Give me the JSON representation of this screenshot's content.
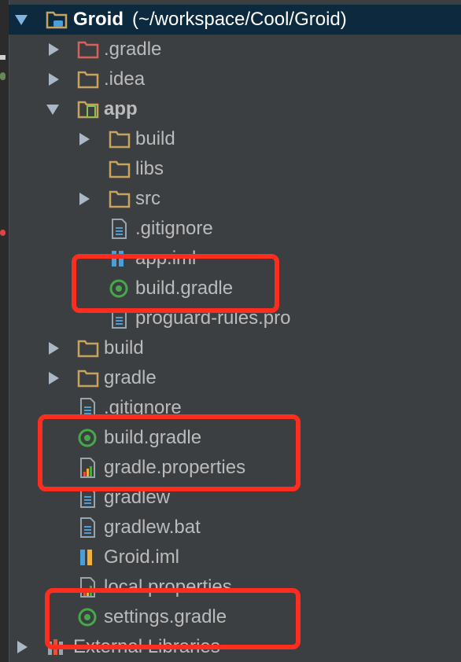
{
  "project": {
    "name": "Groid",
    "path": "(~/workspace/Cool/Groid)"
  },
  "items": {
    "gradle_dir": ".gradle",
    "idea_dir": ".idea",
    "app_dir": "app",
    "app_build": "build",
    "app_libs": "libs",
    "app_src": "src",
    "app_gitignore": ".gitignore",
    "app_iml": "app.iml",
    "app_build_gradle": "build.gradle",
    "app_proguard": "proguard-rules.pro",
    "root_build": "build",
    "root_gradle": "gradle",
    "root_gitignore": ".gitignore",
    "root_build_gradle": "build.gradle",
    "root_gradle_properties": "gradle.properties",
    "root_gradlew": "gradlew",
    "root_gradlew_bat": "gradlew.bat",
    "root_iml": "Groid.iml",
    "root_local_properties": "local.properties",
    "root_settings_gradle": "settings.gradle",
    "external_libraries": "External Libraries"
  },
  "colors": {
    "background": "#3c3f41",
    "selection": "#0d293e",
    "text": "#bbbbbb",
    "folder": "#c7a35e",
    "gradle_icon": "#47a84a",
    "highlight": "#ff2d1f"
  }
}
